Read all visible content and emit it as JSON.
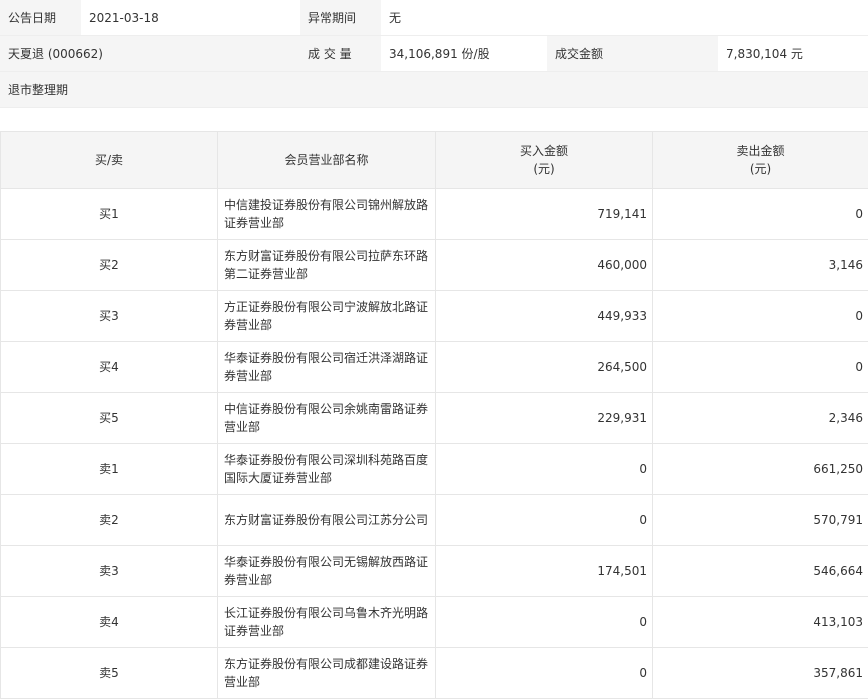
{
  "info": {
    "announce_date_label": "公告日期",
    "announce_date": "2021-03-18",
    "abnormal_period_label": "异常期间",
    "abnormal_period": "无",
    "stock_name": "天夏退 (000662)",
    "volume_label": "成 交 量",
    "volume": "34,106,891 份/股",
    "turnover_label": "成交金额",
    "turnover": "7,830,104 元",
    "reason": "退市整理期"
  },
  "table": {
    "headers": {
      "direction": "买/卖",
      "branch": "会员营业部名称",
      "buy_line1": "买入金额",
      "buy_line2": "(元)",
      "sell_line1": "卖出金额",
      "sell_line2": "(元)"
    },
    "rows": [
      {
        "dir": "买1",
        "name_l1": "中信建投证券股份有限公司锦州解放路",
        "name_l2": "证券营业部",
        "buy": "719,141",
        "sell": "0"
      },
      {
        "dir": "买2",
        "name_l1": "东方财富证券股份有限公司拉萨东环路",
        "name_l2": "第二证券营业部",
        "buy": "460,000",
        "sell": "3,146"
      },
      {
        "dir": "买3",
        "name_l1": "方正证券股份有限公司宁波解放北路证",
        "name_l2": "券营业部",
        "buy": "449,933",
        "sell": "0"
      },
      {
        "dir": "买4",
        "name_l1": "华泰证券股份有限公司宿迁洪泽湖路证",
        "name_l2": "券营业部",
        "buy": "264,500",
        "sell": "0"
      },
      {
        "dir": "买5",
        "name_l1": "中信证券股份有限公司余姚南雷路证券",
        "name_l2": "营业部",
        "buy": "229,931",
        "sell": "2,346"
      },
      {
        "dir": "卖1",
        "name_l1": "华泰证券股份有限公司深圳科苑路百度",
        "name_l2": "国际大厦证券营业部",
        "buy": "0",
        "sell": "661,250"
      },
      {
        "dir": "卖2",
        "name_l1": "东方财富证券股份有限公司江苏分公司",
        "name_l2": "",
        "buy": "0",
        "sell": "570,791"
      },
      {
        "dir": "卖3",
        "name_l1": "华泰证券股份有限公司无锡解放西路证",
        "name_l2": "券营业部",
        "buy": "174,501",
        "sell": "546,664"
      },
      {
        "dir": "卖4",
        "name_l1": "长江证券股份有限公司乌鲁木齐光明路",
        "name_l2": "证券营业部",
        "buy": "0",
        "sell": "413,103"
      },
      {
        "dir": "卖5",
        "name_l1": "东方证券股份有限公司成都建设路证券",
        "name_l2": "营业部",
        "buy": "0",
        "sell": "357,861"
      }
    ]
  }
}
